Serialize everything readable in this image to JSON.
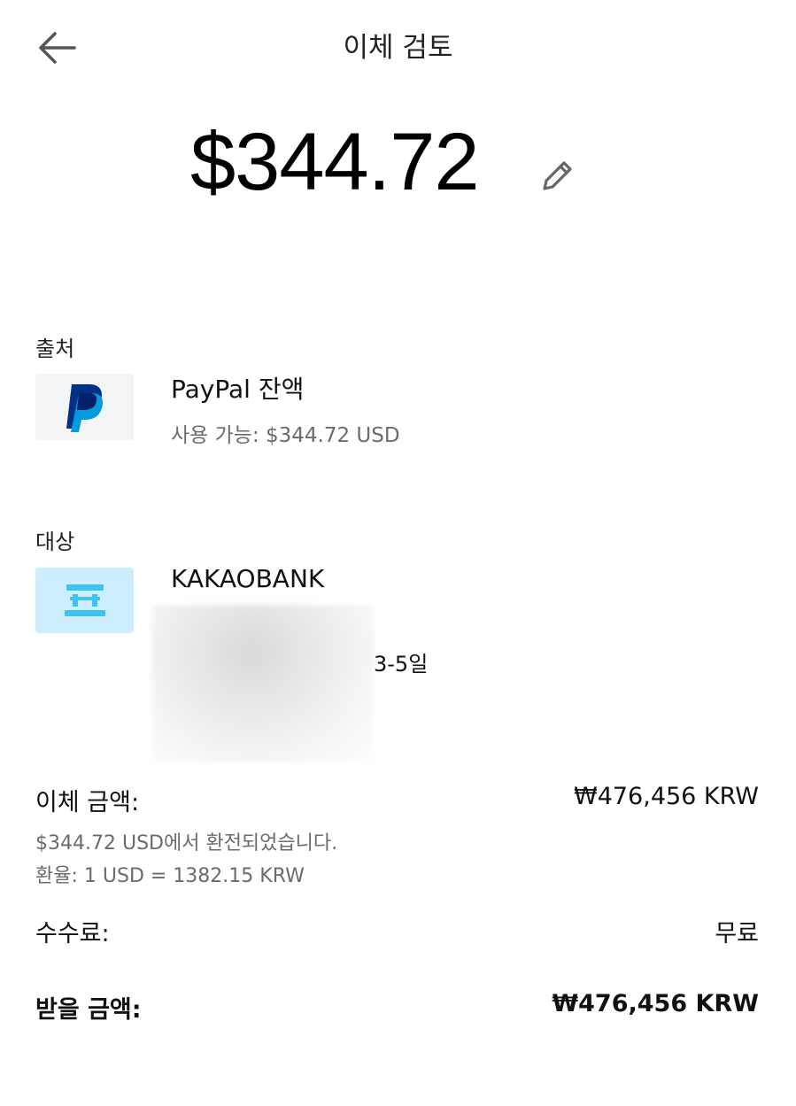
{
  "header": {
    "title": "이체 검토",
    "back_icon": "arrow-left-icon"
  },
  "amount": {
    "value": "$344.72",
    "edit_icon": "pencil-icon"
  },
  "source": {
    "label": "출처",
    "name": "PayPal 잔액",
    "available": "사용 가능: $344.72 USD",
    "logo": "paypal-logo",
    "brand_colors": [
      "#003087",
      "#009cde",
      "#012169"
    ]
  },
  "destination": {
    "label": "대상",
    "bank_name": "KAKAOBANK",
    "days": "3-5일",
    "icon": "bank-icon",
    "icon_bg": "#cdeeff",
    "icon_color": "#3cc3f2"
  },
  "summary": {
    "transfer_label": "이체 금액:",
    "transfer_value": "₩476,456 KRW",
    "converted_note": "$344.72 USD에서 환전되었습니다.",
    "rate_note": "환율: 1 USD = 1382.15 KRW",
    "fee_label": "수수료:",
    "fee_value": "무료",
    "receive_label": "받을 금액:",
    "receive_value": "₩476,456 KRW"
  }
}
